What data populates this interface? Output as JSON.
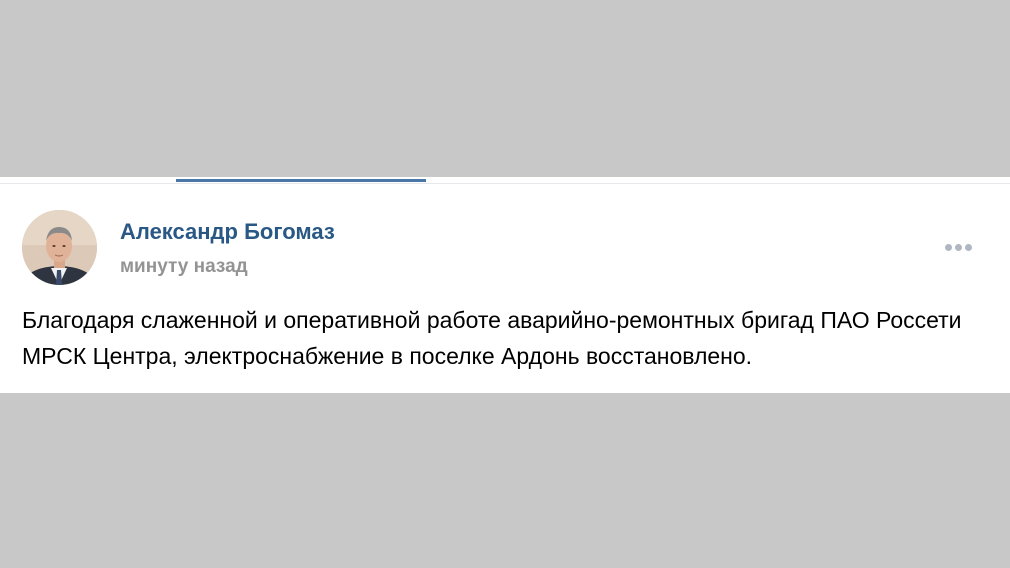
{
  "post": {
    "author": "Александр Богомаз",
    "time": "минуту назад",
    "text": "Благодаря слаженной и оперативной работе аварийно-ремонтных бригад ПАО Россети МРСК Центра, электроснабжение в поселке Ардонь восстановлено.",
    "avatar_icon": "author-portrait",
    "more_icon": "more-horizontal-icon"
  },
  "colors": {
    "background": "#c8c8c8",
    "card": "#ffffff",
    "author_link": "#2a5885",
    "meta_text": "#939393",
    "body_text": "#000000",
    "tab_indicator": "#4a76a8",
    "more_dots": "#aeb7c2"
  }
}
